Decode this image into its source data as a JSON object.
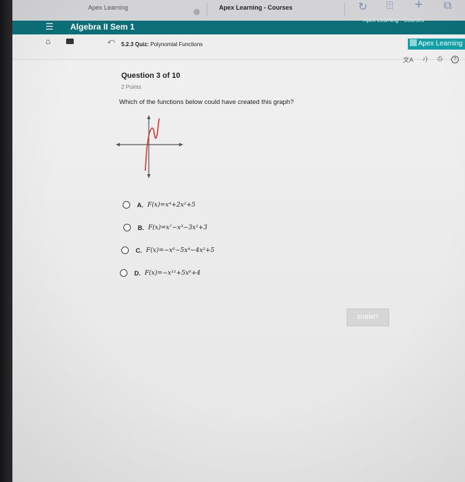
{
  "browser": {
    "tabs": [
      {
        "label": "Apex Learning"
      },
      {
        "label": "Apex Learning - Courses"
      },
      {
        "label": "Apex Learning - Courses"
      }
    ]
  },
  "app": {
    "course_title": "Algebra II Sem 1",
    "breadcrumb_code": "5.2.3",
    "breadcrumb_kind": "Quiz:",
    "breadcrumb_name": "Polynomial Functions",
    "brand": "Apex Learning"
  },
  "question": {
    "title": "Question 3 of 10",
    "points": "2 Points",
    "prompt": "Which of the functions below could have created this graph?",
    "options": [
      {
        "letter": "A.",
        "expr": "F(x)=x⁴+2x²+5"
      },
      {
        "letter": "B.",
        "expr": "F(x)=x⁷−x³−3x²+3"
      },
      {
        "letter": "C.",
        "expr": "F(x)=−x⁶−5x⁴−4x²+5"
      },
      {
        "letter": "D.",
        "expr": "F(x)=−x¹¹+5x⁶+4"
      }
    ],
    "submit_label": "SUBMIT"
  },
  "icons": {
    "reload": "reload-icon",
    "share": "share-icon",
    "new_tab": "plus-icon",
    "tabs": "tabs-icon",
    "menu": "menu-icon",
    "home": "home-icon",
    "briefcase": "briefcase-icon",
    "back": "back-icon",
    "translate": "translate-icon",
    "audio": "audio-icon",
    "print": "print-icon",
    "help": "help-icon"
  },
  "colors": {
    "appbar": "#0c6f78",
    "brand": "#12a0a8",
    "graph_axes": "#555555",
    "graph_curve": "#d9362b"
  }
}
